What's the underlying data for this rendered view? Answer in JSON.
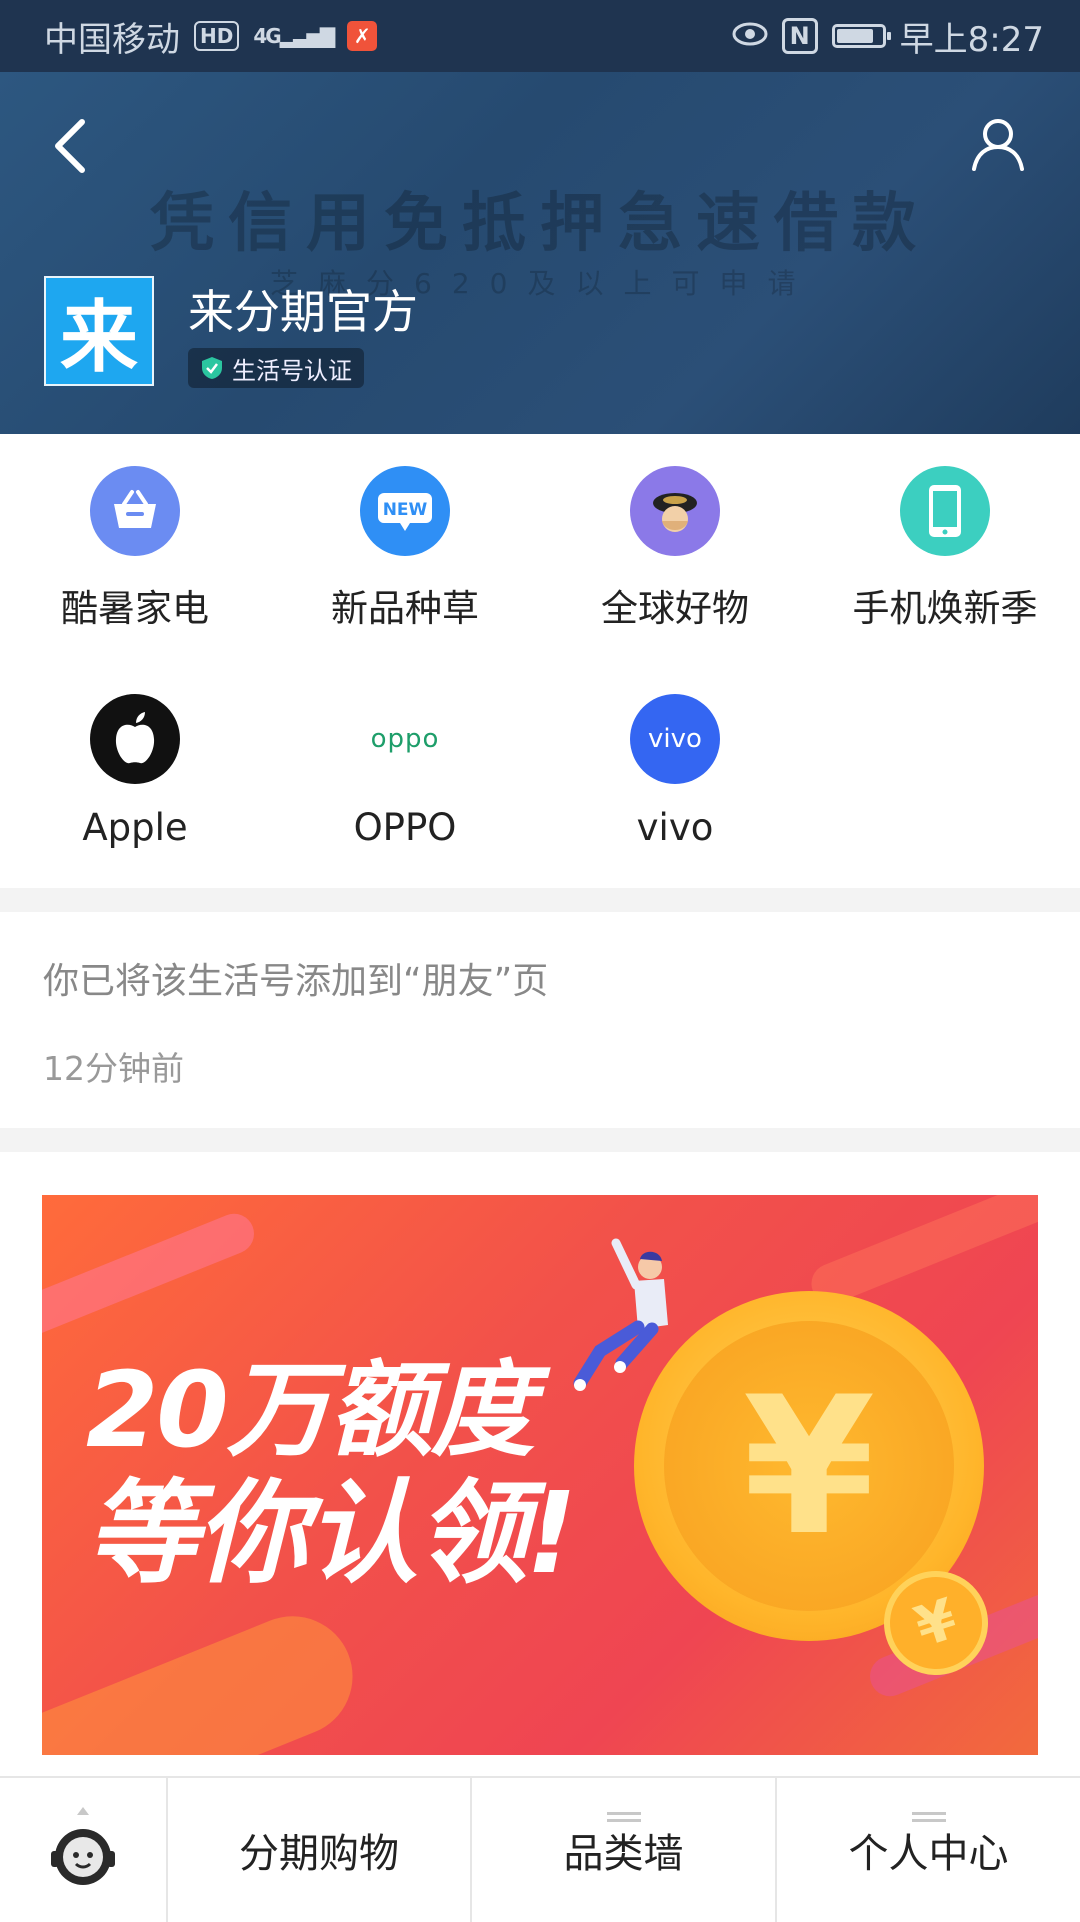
{
  "status_bar": {
    "carrier": "中国移动",
    "hd": "HD",
    "network": "4G",
    "time": "早上8:27",
    "nfc": "N"
  },
  "header": {
    "background_slogan": "凭信用免抵押急速借款",
    "background_sub": "芝麻分620及以上可申请",
    "logo_char": "来",
    "account_name": "来分期官方",
    "verify_label": "生活号认证"
  },
  "categories": [
    {
      "label": "酷暑家电",
      "icon": "basket-icon",
      "color": "#6b8cf2"
    },
    {
      "label": "新品种草",
      "icon": "new-icon",
      "color": "#2f8ff5",
      "icon_text": "NEW"
    },
    {
      "label": "全球好物",
      "icon": "cosmetic-icon",
      "color": "#8b79e8"
    },
    {
      "label": "手机焕新季",
      "icon": "phone-icon",
      "color": "#3ccfc0"
    },
    {
      "label": "Apple",
      "icon": "apple-icon",
      "color": "#111111"
    },
    {
      "label": "OPPO",
      "icon": "oppo-logo-icon",
      "color": "#1e9e6a",
      "icon_text": "oppo"
    },
    {
      "label": "vivo",
      "icon": "vivo-logo-icon",
      "color": "#3466f2",
      "icon_text": "vivo"
    }
  ],
  "notice": {
    "text": "你已将该生活号添加到“朋友”页",
    "time": "12分钟前"
  },
  "banner": {
    "line1": "20万额度",
    "line2": "等你认领!",
    "coin_symbol": "¥"
  },
  "bottom_nav": {
    "items": [
      "分期购物",
      "品类墙",
      "个人中心"
    ]
  },
  "colors": {
    "header_bg": "#264a70",
    "logo_bg": "#1ea7f0",
    "banner_bg": "#f2514a",
    "coin": "#ffb52a"
  }
}
